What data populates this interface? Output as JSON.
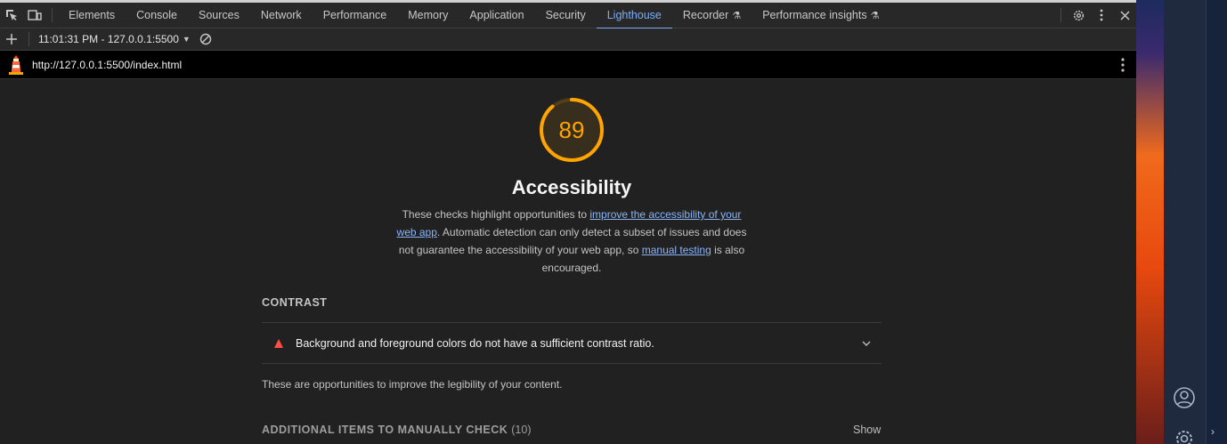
{
  "devtools": {
    "tabs": [
      {
        "label": "Elements"
      },
      {
        "label": "Console"
      },
      {
        "label": "Sources"
      },
      {
        "label": "Network"
      },
      {
        "label": "Performance"
      },
      {
        "label": "Memory"
      },
      {
        "label": "Application"
      },
      {
        "label": "Security"
      },
      {
        "label": "Lighthouse",
        "active": true
      },
      {
        "label": "Recorder",
        "experimental": true
      },
      {
        "label": "Performance insights",
        "experimental": true
      }
    ],
    "active_tab": "Lighthouse",
    "accent_color": "#7cacf8"
  },
  "lighthouse_toolbar": {
    "report_label": "11:01:31 PM - 127.0.0.1:5500"
  },
  "urlbar": {
    "url": "http://127.0.0.1:5500/index.html"
  },
  "report": {
    "score": "89",
    "score_value": 0.89,
    "score_color": "#ffa400",
    "category_title": "Accessibility",
    "description": {
      "part1": "These checks highlight opportunities to ",
      "link1": "improve the accessibility of your web app",
      "part2": ". Automatic detection can only detect a subset of issues and does not guarantee the accessibility of your web app, so ",
      "link2": "manual testing",
      "part3": " is also encouraged."
    },
    "groups": {
      "contrast": {
        "title": "CONTRAST",
        "audit": "Background and foreground colors do not have a sufficient contrast ratio.",
        "audit_status_color": "#ff4e42",
        "description": "These are opportunities to improve the legibility of your content."
      },
      "manual": {
        "title": "ADDITIONAL ITEMS TO MANUALLY CHECK",
        "count": "(10)",
        "show_label": "Show"
      }
    }
  }
}
